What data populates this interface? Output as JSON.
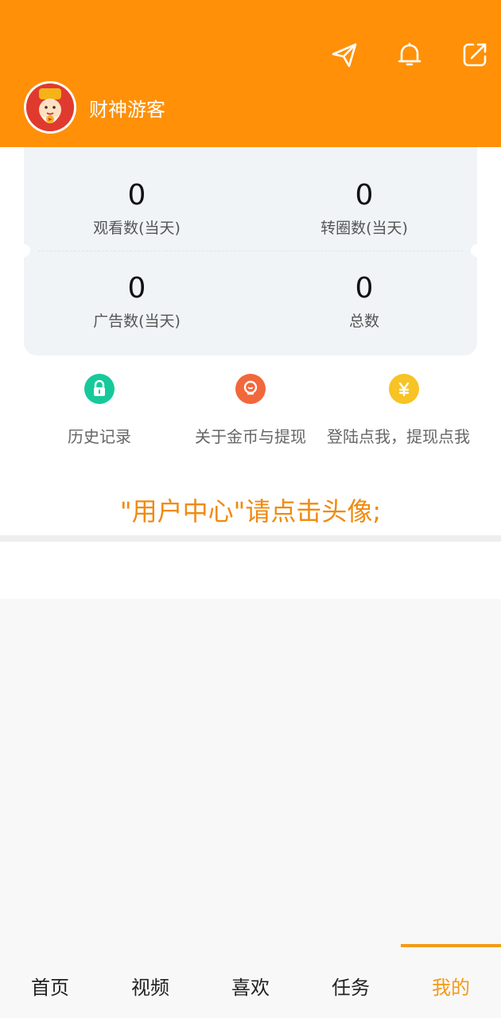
{
  "header": {
    "username": "财神游客",
    "icons": [
      "send-icon",
      "bell-icon",
      "share-icon"
    ]
  },
  "stats": {
    "views_today": {
      "value": "0",
      "label": "观看数(当天)"
    },
    "spins_today": {
      "value": "0",
      "label": "转圈数(当天)"
    },
    "ads_today": {
      "value": "0",
      "label": "广告数(当天)"
    },
    "total": {
      "value": "0",
      "label": "总数"
    }
  },
  "quick_actions": [
    {
      "label": "历史记录",
      "icon": "lock-icon",
      "color": "#16c99b"
    },
    {
      "label": "关于金币与提现",
      "icon": "bulb-icon",
      "color": "#f2673b"
    },
    {
      "label": "登陆点我，提现点我",
      "icon": "yen-icon",
      "color": "#f7c325"
    }
  ],
  "notice": "\"用户中心\"请点击头像;",
  "tabs": [
    {
      "label": "首页"
    },
    {
      "label": "视频"
    },
    {
      "label": "喜欢"
    },
    {
      "label": "任务"
    },
    {
      "label": "我的",
      "active": true
    }
  ],
  "colors": {
    "brand": "#ff9008",
    "accent": "#f39a17",
    "notice": "#f08a10"
  }
}
